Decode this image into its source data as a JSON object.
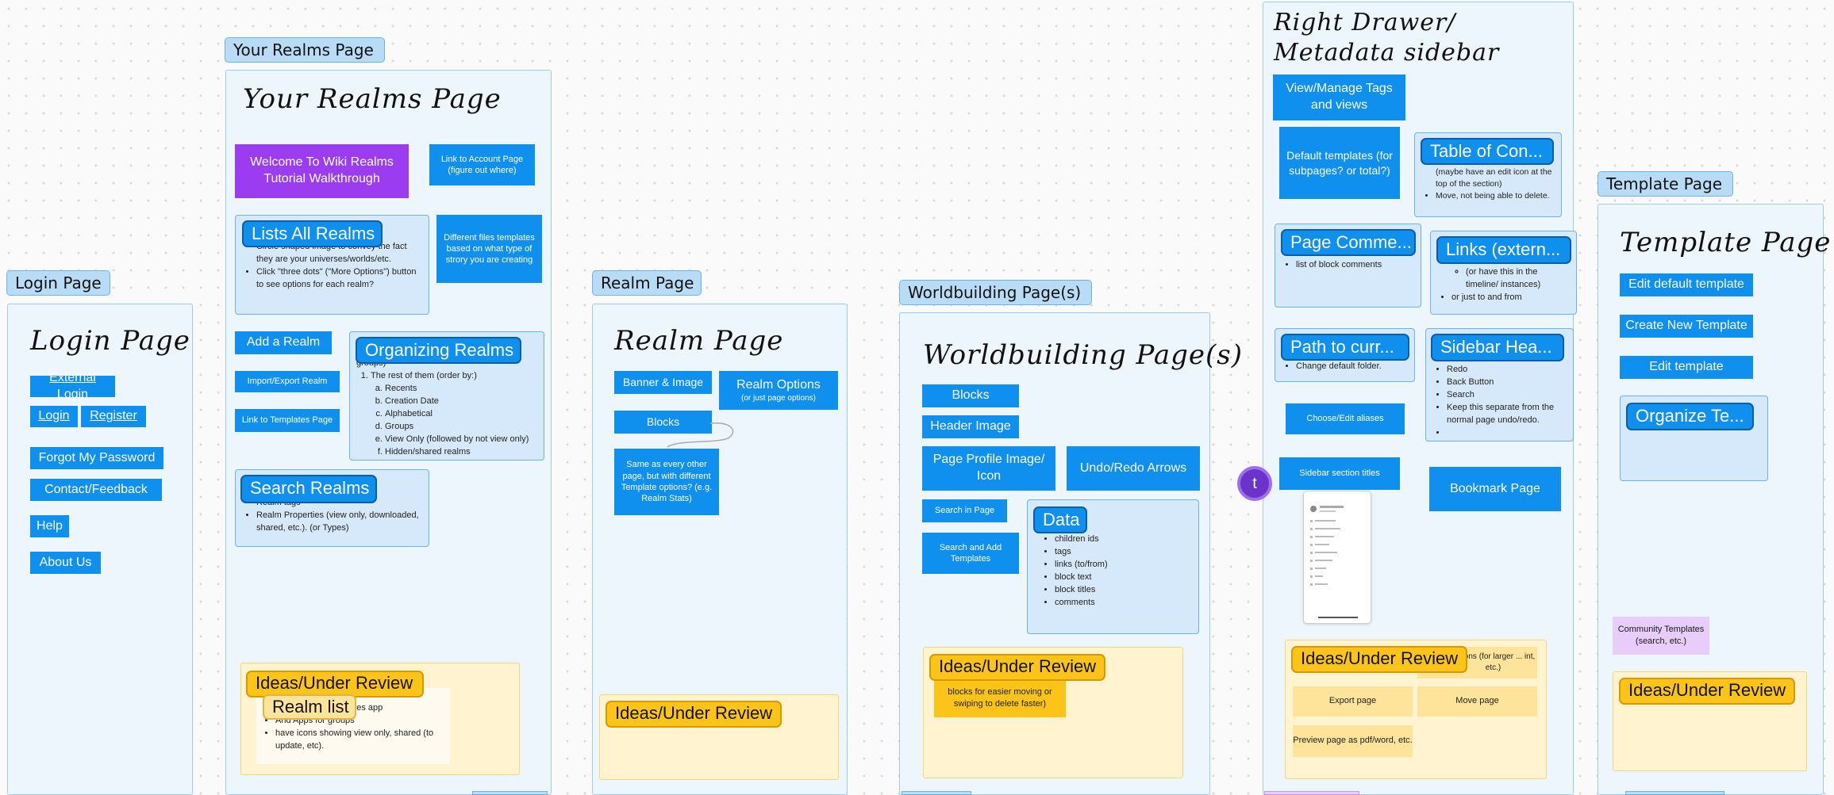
{
  "login": {
    "frame_label": "Login Page",
    "title": "Login Page",
    "external_login": "External Login",
    "login": "Login",
    "register": "Register",
    "forgot_password": "Forgot My Password",
    "contact": "Contact/Feedback",
    "help": "Help",
    "about": "About Us"
  },
  "realms": {
    "frame_label": "Your Realms Page",
    "title": "Your Realms Page",
    "welcome": "Welcome To Wiki Realms Tutorial Walkthrough",
    "account_link": "Link to Account Page (figure out where)",
    "lists_all": {
      "title": "Lists All Realms",
      "items": [
        "Circle shaped image to convey the fact they are your universes/worlds/etc.",
        "Click \"three dots\" (\"More Options\") button to see options for each realm?"
      ]
    },
    "different_files": "Different files templates based on what type of strory you are creating",
    "add_realm": "Add a Realm",
    "import_export": "Import/Export Realm",
    "templates_link": "Link to Templates Page",
    "organizing": {
      "title": "Organizing Realms",
      "intro": "groups)",
      "item1": "The rest of them (order by:)",
      "sub": [
        "Recents",
        "Creation Date",
        "Alphabetical",
        "Groups",
        "View Only (followed by not view only)",
        "Hidden/shared realms"
      ]
    },
    "search": {
      "title": "Search Realms",
      "items": [
        "Realm tags",
        "Realm Properties (view only, downloaded, shared, etc.). (or Types)"
      ]
    },
    "ideas": {
      "title": "Ideas/Under Review",
      "sub_title": "Realm list",
      "items": [
        "ages app",
        "And Apps for groups",
        "have icons showing view only, shared (to update, etc)."
      ]
    }
  },
  "realm": {
    "frame_label": "Realm Page",
    "title": "Realm Page",
    "banner": "Banner & Image",
    "options": "Realm Options",
    "options_sub": "(or just page options)",
    "blocks": "Blocks",
    "same_as": "Same as every other page, but with different Template options? (e.g. Realm Stats)",
    "ideas": "Ideas/Under Review"
  },
  "world": {
    "frame_label": "Worldbuilding Page(s)",
    "title": "Worldbuilding Page(s)",
    "blocks": "Blocks",
    "header_image": "Header Image",
    "profile_image": "Page Profile Image/ Icon",
    "undo_redo": "Undo/Redo Arrows",
    "search_in_page": "Search in Page",
    "search_add_templates": "Search and Add Templates",
    "data": {
      "title": "Data",
      "items": [
        "children ids",
        "tags",
        "links (to/from)",
        "block text",
        "block titles",
        "comments"
      ]
    },
    "ideas": "Ideas/Under Review",
    "ideas_note": "blocks for easier moving or swiping to delete faster)"
  },
  "drawer": {
    "title_line1": "Right Drawer/",
    "title_line2": "Metadata sidebar",
    "view_tags": "View/Manage Tags and views",
    "default_templates": "Default templates (for subpages? or total?)",
    "toc": {
      "title": "Table of Con...",
      "items": [
        "(maybe have an edit icon at the top of the section)",
        "Move, not being able to delete."
      ]
    },
    "comments": {
      "title": "Page Comme...",
      "items": [
        "list of block comments"
      ]
    },
    "links": {
      "title": "Links (extern...",
      "sub": "(or have this in the timeline/ instances)",
      "item": "or just to and from"
    },
    "path": {
      "title": "Path to curr...",
      "item": "Change default folder."
    },
    "sidebar_header": {
      "title": "Sidebar Hea...",
      "items": [
        "Redo",
        "Back Button",
        "Search",
        "Keep this separate from the normal page undo/redo.",
        ""
      ]
    },
    "aliases": "Choose/Edit aliases",
    "section_titles": "Sidebar section titles",
    "bookmark": "Bookmark Page",
    "avatar_letter": "t",
    "ideas": "Ideas/Under Review",
    "ideas_corner": "options (for larger ... int, etc.)",
    "export": "Export page",
    "move": "Move page",
    "preview": "Preview page as pdf/word, etc."
  },
  "template": {
    "frame_label": "Template Page",
    "title": "Template Page",
    "edit_default": "Edit default template",
    "create_new": "Create New Template",
    "edit": "Edit template",
    "organize": "Organize Te...",
    "community": "Community Templates (search, etc.)",
    "ideas": "Ideas/Under Review"
  },
  "colors": {
    "button_blue": "#0f8fee",
    "frame_fill": "#eef6fd",
    "purple": "#9b3cf0",
    "review_yellow": "#fcc419"
  }
}
